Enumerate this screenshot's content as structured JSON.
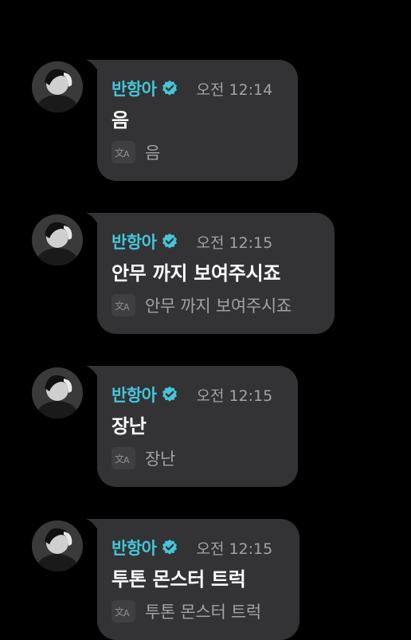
{
  "messages": [
    {
      "sender": "반항아",
      "time": "오전 12:14",
      "text": "음",
      "translation": "음",
      "verified_icon": "verified-badge-icon",
      "translate_icon": "translate-icon"
    },
    {
      "sender": "반항아",
      "time": "오전 12:15",
      "text": "안무 까지 보여주시죠",
      "translation": "안무 까지 보여주시죠",
      "verified_icon": "verified-badge-icon",
      "translate_icon": "translate-icon"
    },
    {
      "sender": "반항아",
      "time": "오전 12:15",
      "text": "장난",
      "translation": "장난",
      "verified_icon": "verified-badge-icon",
      "translate_icon": "translate-icon"
    },
    {
      "sender": "반항아",
      "time": "오전 12:15",
      "text": "투톤 몬스터 트럭",
      "translation": "투톤 몬스터 트럭",
      "verified_icon": "verified-badge-icon",
      "translate_icon": "translate-icon"
    }
  ],
  "colors": {
    "background": "#000000",
    "bubble": "#333335",
    "sender": "#43c6d8",
    "time": "#a2a2a6",
    "text": "#ffffff",
    "translation": "#a2a2a6"
  }
}
